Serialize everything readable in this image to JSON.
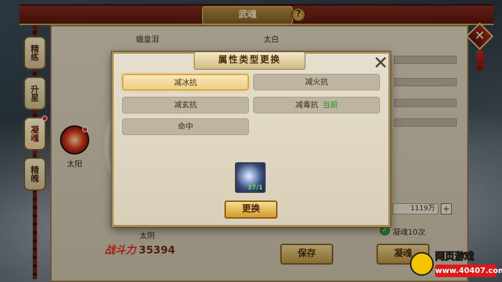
{
  "window": {
    "title": "武魂",
    "help_icon": "question-icon",
    "help_label": "?"
  },
  "side_tabs": [
    {
      "label": "精练",
      "active": false
    },
    {
      "label": "升星",
      "active": false
    },
    {
      "label": "凝魂",
      "active": true,
      "badge": true
    },
    {
      "label": "精魄",
      "active": false
    }
  ],
  "background_panel": {
    "left_name": "娥皇泪",
    "right_name": "太白",
    "orb_label": "太阳",
    "bottom_name": "太阴",
    "power_label": "战斗力",
    "power_value": "35394",
    "money": "1119万",
    "plus_label": "+",
    "check_label": "凝魂10次",
    "save_button": "保存",
    "condense_button": "凝魂"
  },
  "dialog": {
    "title": "属性类型更换",
    "close_label": "✕",
    "options": [
      {
        "label": "减冰抗",
        "selected": true,
        "tag": ""
      },
      {
        "label": "减火抗",
        "selected": false,
        "tag": ""
      },
      {
        "label": "减玄抗",
        "selected": false,
        "tag": ""
      },
      {
        "label": "减毒抗",
        "selected": false,
        "tag": "当前"
      },
      {
        "label": "命中",
        "selected": false,
        "tag": ""
      }
    ],
    "item": {
      "icon": "crystal-orb-icon",
      "count": "37/1"
    },
    "confirm_button": "更换"
  },
  "watermark": {
    "line1": "网页游戏",
    "line2": "www.40407.com"
  }
}
